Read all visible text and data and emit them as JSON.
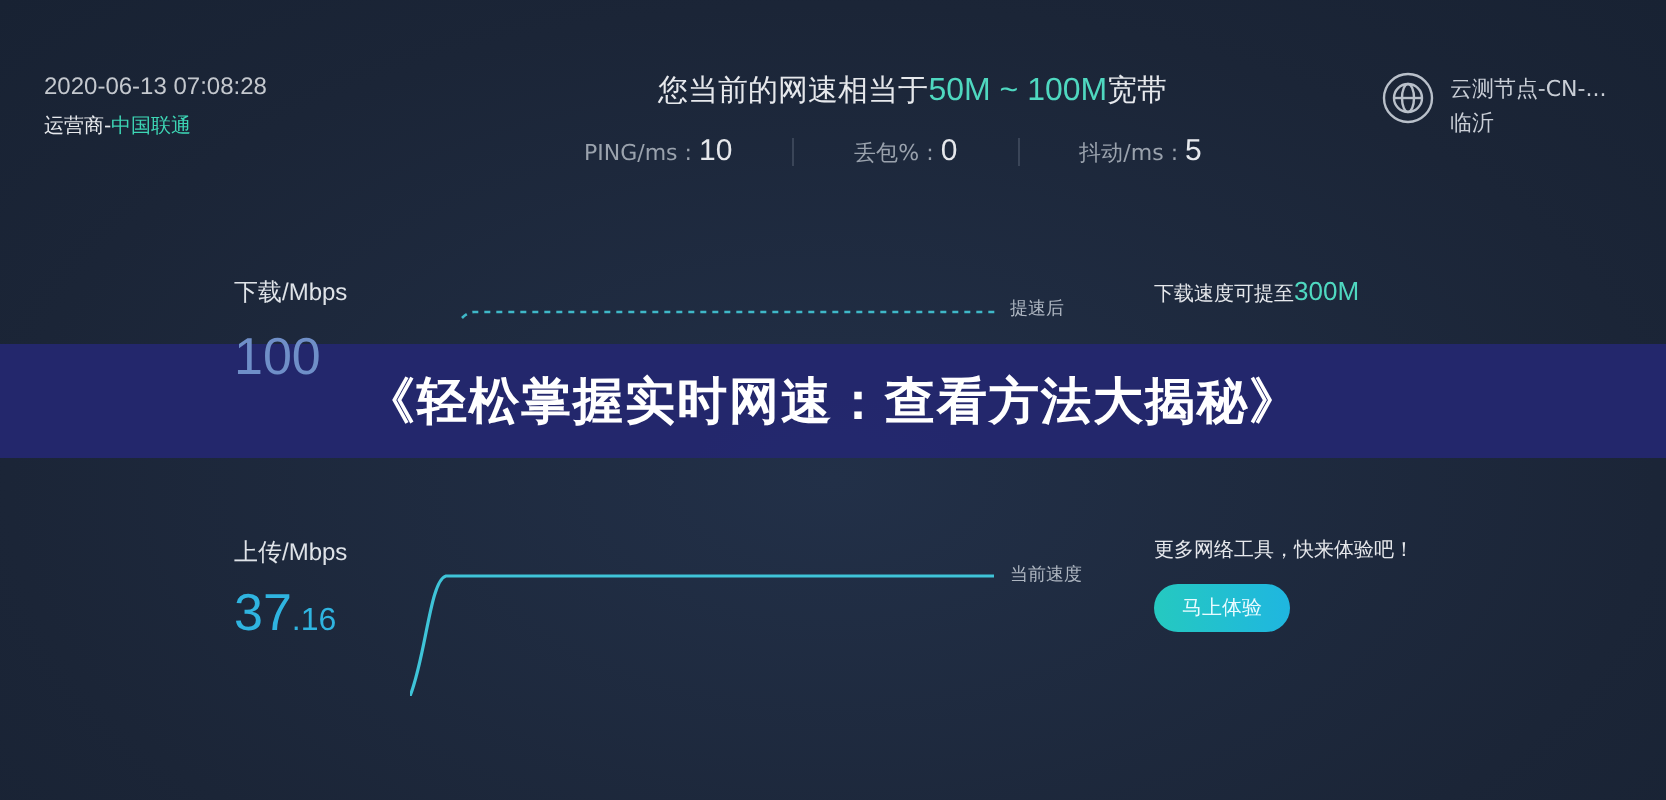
{
  "header": {
    "timestamp": "2020-06-13 07:08:28",
    "isp_label": "运营商-",
    "isp_name": "中国联通",
    "headline_prefix": "您当前的网速相当于",
    "headline_range": "50M ~ 100M",
    "headline_suffix": "宽带",
    "node_name": "云测节点-CN-...",
    "node_city": "临沂"
  },
  "stats": [
    {
      "label": "PING/ms : ",
      "value": "10"
    },
    {
      "label": "丢包% : ",
      "value": "0"
    },
    {
      "label": "抖动/ms : ",
      "value": "5"
    }
  ],
  "download": {
    "label": "下载/Mbps",
    "value": "100",
    "curve_label": "提速后",
    "promo_prefix": "下载速度可提至",
    "promo_value": "300M"
  },
  "upload": {
    "label": "上传/Mbps",
    "value_int": "37",
    "value_dec": ".16",
    "curve_label": "当前速度",
    "promo": "更多网络工具，快来体验吧！",
    "button": "马上体验"
  },
  "banner": {
    "title": "《轻松掌握实时网速：查看方法大揭秘》"
  }
}
